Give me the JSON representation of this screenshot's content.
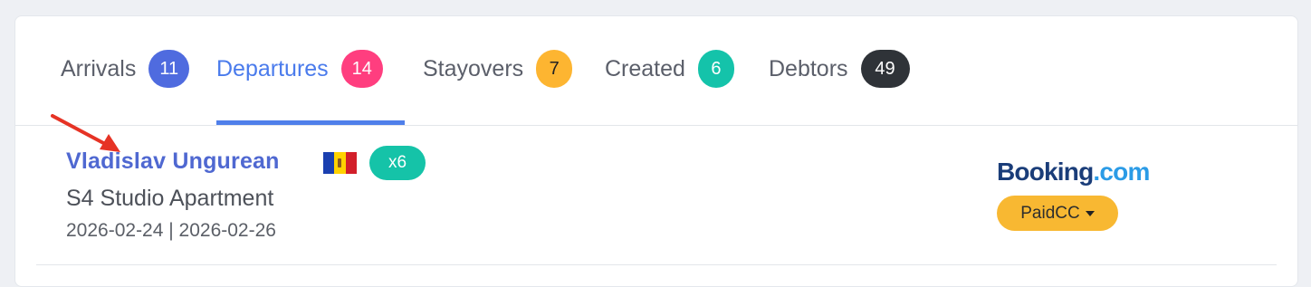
{
  "tabs": [
    {
      "label": "Arrivals",
      "count": "11",
      "color": "#4f6bdf",
      "active": false
    },
    {
      "label": "Departures",
      "count": "14",
      "color": "#ff3e7f",
      "active": true
    },
    {
      "label": "Stayovers",
      "count": "7",
      "color": "#fdb531",
      "active": false
    },
    {
      "label": "Created",
      "count": "6",
      "color": "#14c3aa",
      "active": false
    },
    {
      "label": "Debtors",
      "count": "49",
      "color": "#2f3338",
      "active": false
    }
  ],
  "booking": {
    "guest_name": "Vladislav Ungurean",
    "country_flag": "moldova-flag-icon",
    "stay_count": "x6",
    "room": "S4 Studio Apartment",
    "dates": "2026-02-24 | 2026-02-26",
    "source": {
      "part1": "Booking",
      "part2": ".com"
    },
    "payment_status": "PaidCC"
  },
  "annotation": {
    "icon": "red-arrow-icon",
    "color": "#e63325"
  }
}
